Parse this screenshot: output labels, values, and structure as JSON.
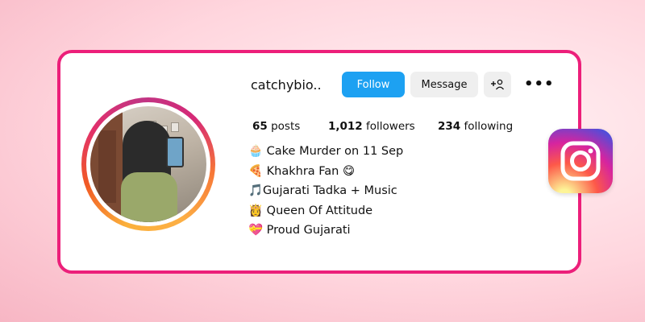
{
  "profile": {
    "username": "catchybio..",
    "follow_label": "Follow",
    "message_label": "Message",
    "add_user_icon": "person-plus-icon",
    "more_label": "•••",
    "stats": {
      "posts_count": "65",
      "posts_label": "posts",
      "followers_count": "1,012",
      "followers_label": "followers",
      "following_count": "234",
      "following_label": "following"
    },
    "bio": [
      "🧁 Cake Murder on 11 Sep",
      "🍕 Khakhra Fan 😋",
      "🎵Gujarati Tadka + Music",
      "👸 Queen Of Attitude",
      "💝 Proud Gujarati"
    ]
  },
  "colors": {
    "card_border": "#ec1f7a",
    "follow_button": "#1da1f2",
    "secondary_button": "#efefef"
  },
  "logo": {
    "icon": "instagram-logo-icon"
  }
}
